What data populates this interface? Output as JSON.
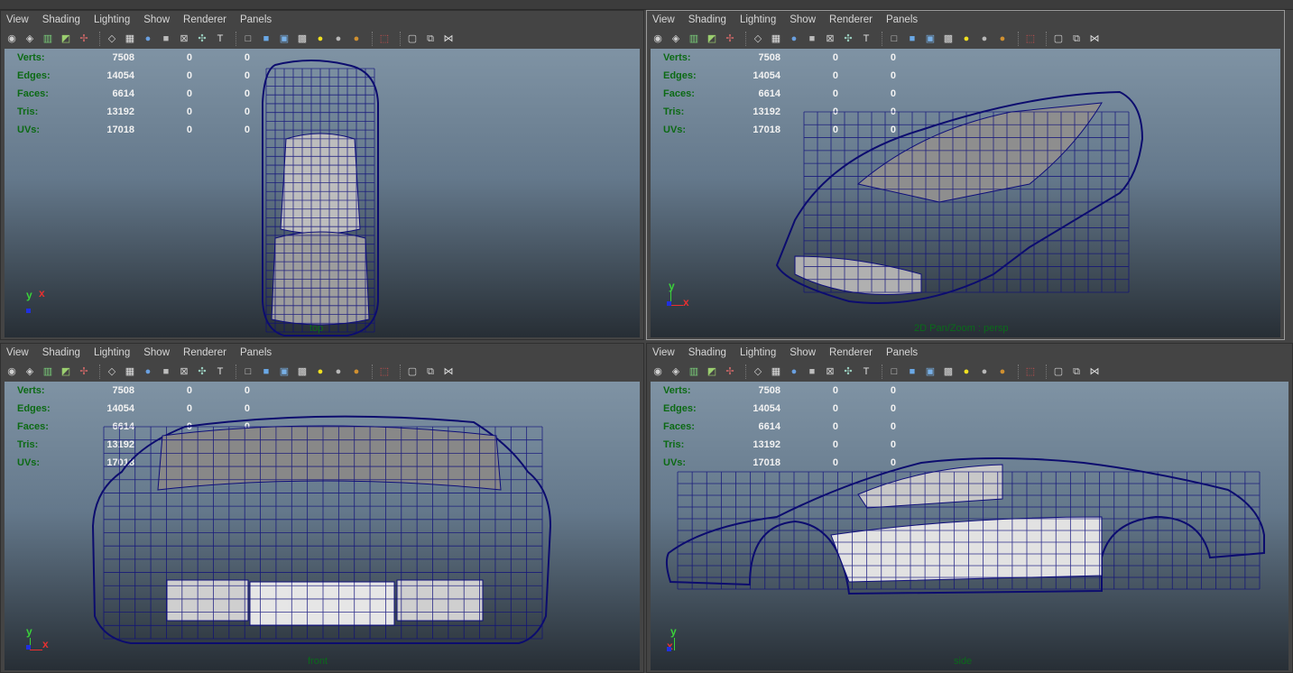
{
  "menu": [
    "View",
    "Shading",
    "Lighting",
    "Show",
    "Renderer",
    "Panels"
  ],
  "toolbar_icons": [
    "camera-attributes-icon",
    "camera-select-icon",
    "bookmark-icon",
    "image-plane-icon",
    "grid-2d-pan-icon",
    "wireframe-icon",
    "grid-icon",
    "smooth-shade-icon",
    "flat-shade-icon",
    "xray-icon",
    "xray-joints-icon",
    "textured-icon",
    "cube-wire-icon",
    "cube-shaded-icon",
    "cube-textured-icon",
    "checker-icon",
    "light-default-icon",
    "light-all-icon",
    "light-flat-icon",
    "isolate-select-icon",
    "resolution-gate-icon",
    "film-gate-icon",
    "share-icon"
  ],
  "hud": {
    "rows": [
      {
        "label": "Verts:",
        "v": "7508",
        "a": "0",
        "b": "0"
      },
      {
        "label": "Edges:",
        "v": "14054",
        "a": "0",
        "b": "0"
      },
      {
        "label": "Faces:",
        "v": "6614",
        "a": "0",
        "b": "0"
      },
      {
        "label": "Tris:",
        "v": "13192",
        "a": "0",
        "b": "0"
      },
      {
        "label": "UVs:",
        "v": "17018",
        "a": "0",
        "b": "0"
      }
    ]
  },
  "axis": {
    "y": "y",
    "x": "x"
  },
  "viewports": {
    "top": {
      "caption": "top"
    },
    "persp": {
      "caption": "2D Pan/Zoom : persp"
    },
    "front": {
      "caption": "front"
    },
    "side": {
      "caption": "side"
    }
  },
  "colors": {
    "hud_label": "#0c6a14",
    "hud_value": "#f2f2f2",
    "wire": "#0e0e7a",
    "background_top": "#7f93a4",
    "background_bottom": "#272e35"
  }
}
